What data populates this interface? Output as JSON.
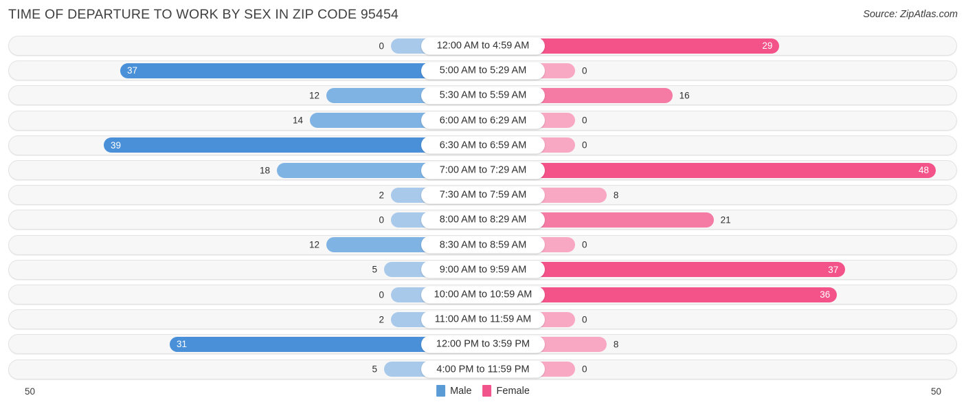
{
  "header": {
    "title": "TIME OF DEPARTURE TO WORK BY SEX IN ZIP CODE 95454",
    "source": "Source: ZipAtlas.com"
  },
  "legend": {
    "male_label": "Male",
    "female_label": "Female",
    "male_color": "#5B9BD5",
    "female_color": "#F0548A"
  },
  "axis": {
    "left_max": "50",
    "right_max": "50"
  },
  "colors": {
    "male_strong": "#4A90D9",
    "male_mid": "#7FB3E3",
    "male_light": "#A8C9EA",
    "female_strong": "#F4538A",
    "female_mid": "#F57BA4",
    "female_light": "#F9A8C4",
    "track_bg": "#F7F7F7",
    "track_border": "#E3E3E3"
  },
  "chart_data": {
    "type": "bar",
    "title": "TIME OF DEPARTURE TO WORK BY SEX IN ZIP CODE 95454",
    "orientation": "horizontal-diverging",
    "xlabel": "",
    "ylabel": "",
    "axis_max": 50,
    "grid": false,
    "legend_position": "bottom-center",
    "categories": [
      "12:00 AM to 4:59 AM",
      "5:00 AM to 5:29 AM",
      "5:30 AM to 5:59 AM",
      "6:00 AM to 6:29 AM",
      "6:30 AM to 6:59 AM",
      "7:00 AM to 7:29 AM",
      "7:30 AM to 7:59 AM",
      "8:00 AM to 8:29 AM",
      "8:30 AM to 8:59 AM",
      "9:00 AM to 9:59 AM",
      "10:00 AM to 10:59 AM",
      "11:00 AM to 11:59 AM",
      "12:00 PM to 3:59 PM",
      "4:00 PM to 11:59 PM"
    ],
    "series": [
      {
        "name": "Male",
        "values": [
          0,
          37,
          12,
          14,
          39,
          18,
          2,
          0,
          12,
          5,
          0,
          2,
          31,
          5
        ]
      },
      {
        "name": "Female",
        "values": [
          29,
          0,
          16,
          0,
          0,
          48,
          8,
          21,
          0,
          37,
          36,
          0,
          8,
          0
        ]
      }
    ]
  }
}
